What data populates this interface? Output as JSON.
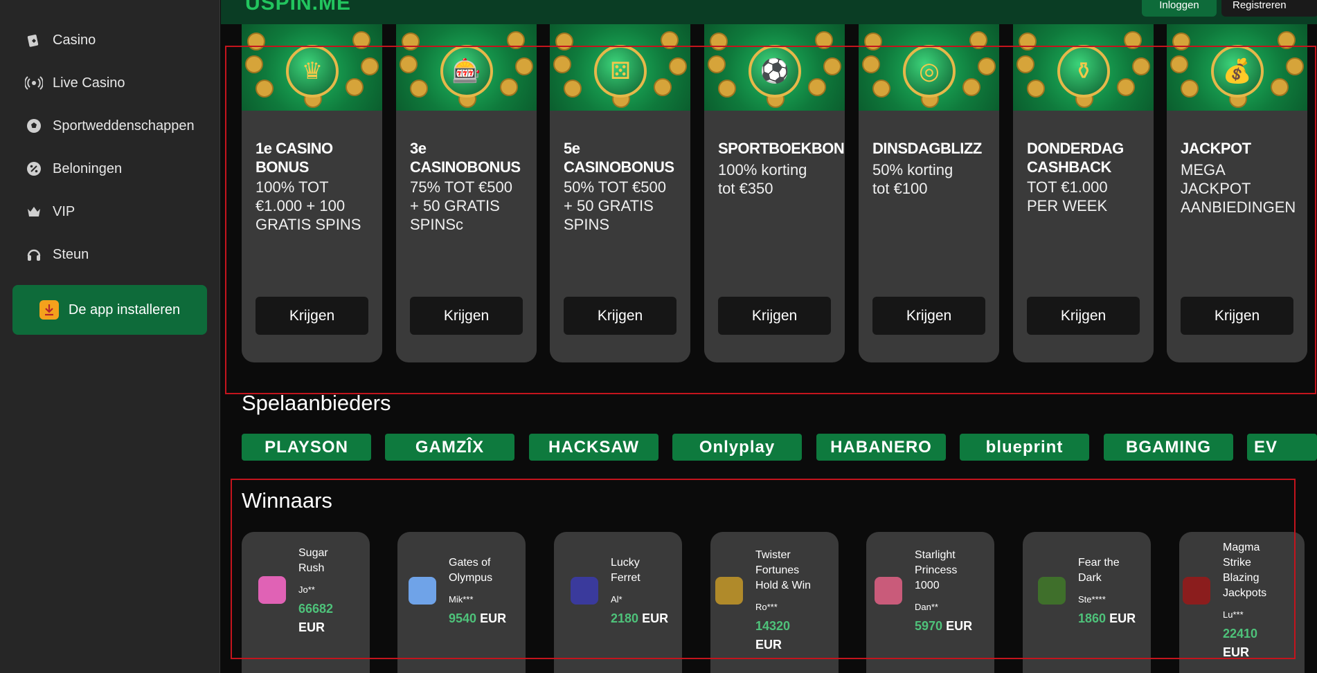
{
  "header": {
    "logo": "USPIN.ME",
    "login": "Inloggen",
    "register": "Registreren"
  },
  "sidebar": {
    "items": [
      {
        "label": "Casino",
        "icon": "casino-icon"
      },
      {
        "label": "Live Casino",
        "icon": "live-broadcast-icon"
      },
      {
        "label": "Sportweddenschappen",
        "icon": "soccer-ball-icon"
      },
      {
        "label": "Beloningen",
        "icon": "percent-badge-icon"
      },
      {
        "label": "VIP",
        "icon": "crown-icon"
      },
      {
        "label": "Steun",
        "icon": "headset-icon"
      }
    ],
    "install_label": "De app installeren"
  },
  "bonuses": [
    {
      "title": "1e CASINO\nBONUS",
      "desc": "100% TOT\n€1.000 + 100\nGRATIS SPINS",
      "button": "Krijgen",
      "image": "crown-chip-image"
    },
    {
      "title": "3e\nCASINOBONUS",
      "desc": "75% TOT €500\n+ 50 GRATIS\nSPINSc",
      "button": "Krijgen",
      "image": "slot-machine-image"
    },
    {
      "title": "5e\nCASINOBONUS",
      "desc": "50% TOT €500\n+ 50 GRATIS\nSPINS",
      "button": "Krijgen",
      "image": "dice-image"
    },
    {
      "title": "SPORTBOEKBONUS",
      "desc": "100% korting\ntot €350",
      "button": "Krijgen",
      "image": "soccer-ball-image"
    },
    {
      "title": "DINSDAGBLIZZ",
      "desc": "50% korting\ntot €100",
      "button": "Krijgen",
      "image": "roulette-image"
    },
    {
      "title": "DONDERDAG\nCASHBACK",
      "desc": "TOT €1.000\nPER WEEK",
      "button": "Krijgen",
      "image": "pot-of-gold-image"
    },
    {
      "title": "JACKPOT",
      "desc": "MEGA\nJACKPOT\nAANBIEDINGEN",
      "button": "Krijgen",
      "image": "golden-slot-image"
    }
  ],
  "providers_title": "Spelaanbieders",
  "providers": [
    "PLAYSON",
    "GAMZÎX",
    "HACKSAW",
    "Onlyplay",
    "HABANERO",
    "blueprint",
    "BGAMING",
    "EV"
  ],
  "winners_title": "Winnaars",
  "winners": [
    {
      "game": "Sugar\nRush",
      "user": "Jo**",
      "amount": "66682",
      "currency": "EUR"
    },
    {
      "game": "Gates of\nOlympus",
      "user": "Mik***",
      "amount": "9540",
      "currency": "EUR"
    },
    {
      "game": "Lucky\nFerret",
      "user": "Al*",
      "amount": "2180",
      "currency": "EUR"
    },
    {
      "game": "Twister\nFortunes\nHold & Win",
      "user": "Ro***",
      "amount": "14320",
      "currency": "EUR"
    },
    {
      "game": "Starlight\nPrincess\n1000",
      "user": "Dan**",
      "amount": "5970",
      "currency": "EUR"
    },
    {
      "game": "Fear the\nDark",
      "user": "Ste****",
      "amount": "1860",
      "currency": "EUR"
    },
    {
      "game": "Magma\nStrike\nBlazing\nJackpots",
      "user": "Lu***",
      "amount": "22410",
      "currency": "EUR"
    }
  ],
  "colors": {
    "accent_green": "#0e6b3a",
    "amount_green": "#4ec27a",
    "highlight_red": "#c4141d"
  }
}
